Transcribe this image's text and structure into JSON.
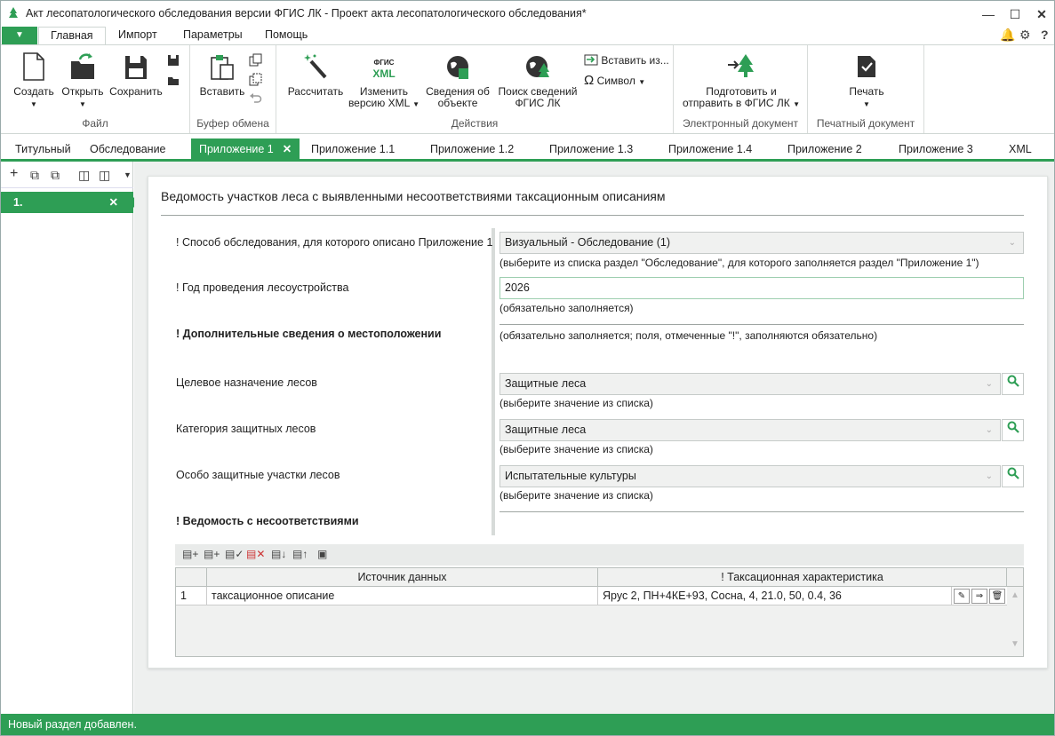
{
  "window": {
    "title": "Акт лесопатологического обследования версии ФГИС ЛК - Проект акта лесопатологического обследования*"
  },
  "menu": {
    "file_arrow": "▼",
    "tabs": [
      "Главная",
      "Импорт",
      "Параметры",
      "Помощь"
    ],
    "help": "?"
  },
  "ribbon": {
    "groups": {
      "file": "Файл",
      "clipboard": "Буфер обмена",
      "actions": "Действия",
      "edoc": "Электронный документ",
      "print": "Печатный документ"
    },
    "buttons": {
      "create": "Создать",
      "open": "Открыть",
      "save": "Сохранить",
      "paste": "Вставить",
      "calc": "Рассчитать",
      "change_xml_1": "Изменить",
      "change_xml_2": "версию XML",
      "fgis_icon_1": "ФГИС",
      "fgis_icon_2": "XML",
      "object_info_1": "Сведения об",
      "object_info_2": "объекте",
      "search_fgis_1": "Поиск сведений",
      "search_fgis_2": "ФГИС ЛК",
      "insert_from": "Вставить из...",
      "symbol": "Символ",
      "prepare_1": "Подготовить и",
      "prepare_2": "отправить в ФГИС ЛК",
      "print": "Печать"
    }
  },
  "doc_tabs": [
    "Титульный",
    "Обследование",
    "Приложение 1",
    "Приложение 1.1",
    "Приложение 1.2",
    "Приложение 1.3",
    "Приложение 1.4",
    "Приложение 2",
    "Приложение 3",
    "XML"
  ],
  "left": {
    "item": "1."
  },
  "form": {
    "title": "Ведомость участков леса с выявленными несоответствиями таксационным описаниям",
    "survey_method_label": "! Способ обследования, для которого описано Приложение 1",
    "survey_method_value": "Визуальный - Обследование (1)",
    "survey_method_hint": "(выберите из списка раздел \"Обследование\", для которого заполняется раздел \"Приложение 1\")",
    "year_label": "! Год проведения лесоустройства",
    "year_value": "2026",
    "year_hint": "(обязательно заполняется)",
    "location_label": "! Дополнительные сведения о местоположении",
    "location_hint": "(обязательно заполняется; поля, отмеченные \"!\", заполняются обязательно)",
    "purpose_label": "Целевое назначение лесов",
    "purpose_value": "Защитные леса",
    "category_label": "Категория защитных лесов",
    "category_value": "Защитные леса",
    "special_label": "Особо защитные участки лесов",
    "special_value": "Испытательные культуры",
    "list_hint": "(выберите значение из списка)",
    "mismatch_label": "! Ведомость с несоответствиями"
  },
  "grid": {
    "columns": [
      "Источник данных",
      "! Таксационная характеристика"
    ],
    "rows": [
      {
        "n": "1",
        "source": "таксационное описание",
        "char": "Ярус 2, ПН+4КЕ+93, Сосна, 4, 21.0, 50, 0.4, 36"
      }
    ]
  },
  "status": "Новый раздел добавлен."
}
